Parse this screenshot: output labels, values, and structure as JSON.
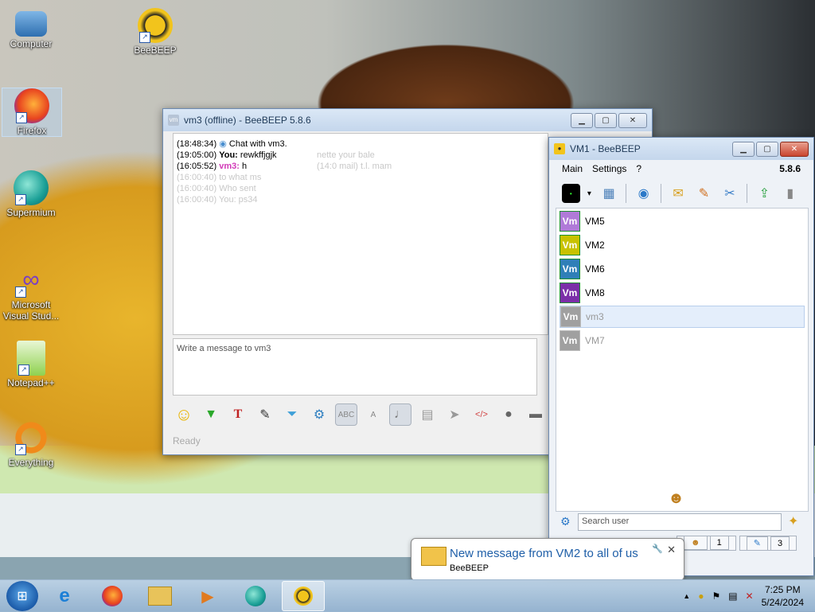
{
  "desktop": {
    "icons": [
      {
        "label": "Computer"
      },
      {
        "label": "BeeBEEP"
      },
      {
        "label": "Firefox"
      },
      {
        "label": "Supermium"
      },
      {
        "label": "Microsoft Visual Stud..."
      },
      {
        "label": "Notepad++"
      },
      {
        "label": "Everything"
      }
    ]
  },
  "chat_window": {
    "title": "vm3 (offline) - BeeBEEP 5.8.6",
    "messages": [
      {
        "time": "(18:48:34)",
        "who": "",
        "text": "Chat with vm3."
      },
      {
        "time": "(19:05:00)",
        "who": "You:",
        "text": "rewkffjgjk"
      },
      {
        "time": "(16:05:52)",
        "who": "vm3:",
        "text": "h"
      }
    ],
    "ghost_lines": [
      "nette your bale",
      "(14:0 mail) t.l. mam",
      "(16:00:40) to what ms",
      "(16:00:40) Who sent",
      "(16:00:40) You: ps34"
    ],
    "input_placeholder": "Write a message to vm3",
    "status": "Ready"
  },
  "contacts_window": {
    "title": "VM1 - BeeBEEP",
    "menu": [
      "Main",
      "Settings",
      "?"
    ],
    "version": "5.8.6",
    "users": [
      {
        "avatar": "Vm",
        "name": "VM5",
        "color": "#b07ad8",
        "online": true
      },
      {
        "avatar": "Vm",
        "name": "VM2",
        "color": "#c8c200",
        "online": true
      },
      {
        "avatar": "Vm",
        "name": "VM6",
        "color": "#2f7fb8",
        "online": true
      },
      {
        "avatar": "Vm",
        "name": "VM8",
        "color": "#7b2fa8",
        "online": true
      },
      {
        "avatar": "Vm",
        "name": "vm3",
        "color": "#a0a0a0",
        "online": false
      },
      {
        "avatar": "Vm",
        "name": "VM7",
        "color": "#a0a0a0",
        "online": false
      }
    ],
    "search_placeholder": "Search user",
    "tab_counts": [
      "1",
      "3"
    ]
  },
  "notification": {
    "title": "New message from VM2 to all of us",
    "source": "BeeBEEP"
  },
  "taskbar": {
    "time": "7:25 PM",
    "date": "5/24/2024"
  }
}
